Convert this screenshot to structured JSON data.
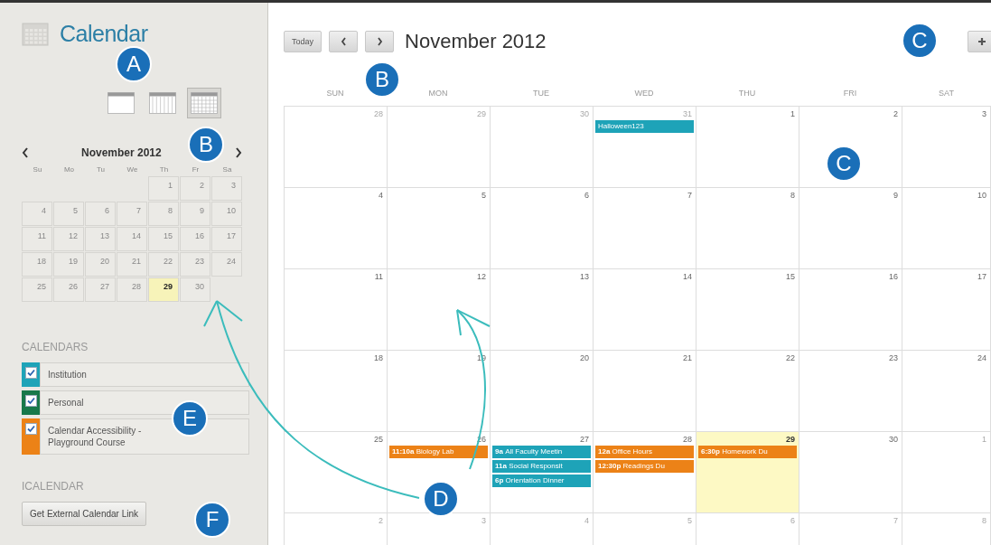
{
  "sidebar": {
    "title": "Calendar",
    "views": [
      {
        "kind": "day",
        "selected": false
      },
      {
        "kind": "week",
        "selected": false
      },
      {
        "kind": "month",
        "selected": true
      }
    ],
    "mini_calendar": {
      "month": "November 2012",
      "weekdays": [
        "Su",
        "Mo",
        "Tu",
        "We",
        "Th",
        "Fr",
        "Sa"
      ],
      "weeks": [
        [
          {
            "kind": "blank"
          },
          {
            "kind": "blank"
          },
          {
            "kind": "blank"
          },
          {
            "kind": "blank"
          },
          {
            "kind": "day",
            "day": "1",
            "today": false
          },
          {
            "kind": "day",
            "day": "2",
            "today": false
          },
          {
            "kind": "day",
            "day": "3",
            "today": false
          }
        ],
        [
          {
            "kind": "day",
            "day": "4",
            "today": false
          },
          {
            "kind": "day",
            "day": "5",
            "today": false
          },
          {
            "kind": "day",
            "day": "6",
            "today": false
          },
          {
            "kind": "day",
            "day": "7",
            "today": false
          },
          {
            "kind": "day",
            "day": "8",
            "today": false
          },
          {
            "kind": "day",
            "day": "9",
            "today": false
          },
          {
            "kind": "day",
            "day": "10",
            "today": false
          }
        ],
        [
          {
            "kind": "day",
            "day": "11",
            "today": false
          },
          {
            "kind": "day",
            "day": "12",
            "today": false
          },
          {
            "kind": "day",
            "day": "13",
            "today": false
          },
          {
            "kind": "day",
            "day": "14",
            "today": false
          },
          {
            "kind": "day",
            "day": "15",
            "today": false
          },
          {
            "kind": "day",
            "day": "16",
            "today": false
          },
          {
            "kind": "day",
            "day": "17",
            "today": false
          }
        ],
        [
          {
            "kind": "day",
            "day": "18",
            "today": false
          },
          {
            "kind": "day",
            "day": "19",
            "today": false
          },
          {
            "kind": "day",
            "day": "20",
            "today": false
          },
          {
            "kind": "day",
            "day": "21",
            "today": false
          },
          {
            "kind": "day",
            "day": "22",
            "today": false
          },
          {
            "kind": "day",
            "day": "23",
            "today": false
          },
          {
            "kind": "day",
            "day": "24",
            "today": false
          }
        ],
        [
          {
            "kind": "day",
            "day": "25",
            "today": false
          },
          {
            "kind": "day",
            "day": "26",
            "today": false
          },
          {
            "kind": "day",
            "day": "27",
            "today": false
          },
          {
            "kind": "day",
            "day": "28",
            "today": false
          },
          {
            "kind": "day",
            "day": "29",
            "today": true
          },
          {
            "kind": "day",
            "day": "30",
            "today": false
          },
          {
            "kind": "blank"
          }
        ]
      ]
    },
    "calendars_heading": "CALENDARS",
    "calendars": [
      {
        "name": "Institution",
        "checked": true,
        "color": "#1ea3b8"
      },
      {
        "name": "Personal",
        "checked": true,
        "color": "#17784a"
      },
      {
        "name": "Calendar Accessibility - Playground Course",
        "checked": true,
        "color": "#ec8217"
      }
    ],
    "icalendar_heading": "ICALENDAR",
    "link_button": "Get External Calendar Link"
  },
  "main": {
    "today_button": "Today",
    "title": "November 2012",
    "weekdays": [
      "SUN",
      "MON",
      "TUE",
      "WED",
      "THU",
      "FRI",
      "SAT"
    ],
    "weeks": [
      [
        {
          "day": "28",
          "other_month": true,
          "today": false
        },
        {
          "day": "29",
          "other_month": true,
          "today": false
        },
        {
          "day": "30",
          "other_month": true,
          "today": false
        },
        {
          "day": "31",
          "other_month": true,
          "today": false,
          "events": [
            {
              "title": "Halloween123",
              "color": "#1ea3b8"
            }
          ]
        },
        {
          "day": "1",
          "other_month": false,
          "today": false
        },
        {
          "day": "2",
          "other_month": false,
          "today": false
        },
        {
          "day": "3",
          "other_month": false,
          "today": false
        }
      ],
      [
        {
          "day": "4",
          "other_month": false,
          "today": false
        },
        {
          "day": "5",
          "other_month": false,
          "today": false
        },
        {
          "day": "6",
          "other_month": false,
          "today": false
        },
        {
          "day": "7",
          "other_month": false,
          "today": false
        },
        {
          "day": "8",
          "other_month": false,
          "today": false
        },
        {
          "day": "9",
          "other_month": false,
          "today": false
        },
        {
          "day": "10",
          "other_month": false,
          "today": false
        }
      ],
      [
        {
          "day": "11",
          "other_month": false,
          "today": false
        },
        {
          "day": "12",
          "other_month": false,
          "today": false
        },
        {
          "day": "13",
          "other_month": false,
          "today": false
        },
        {
          "day": "14",
          "other_month": false,
          "today": false
        },
        {
          "day": "15",
          "other_month": false,
          "today": false
        },
        {
          "day": "16",
          "other_month": false,
          "today": false
        },
        {
          "day": "17",
          "other_month": false,
          "today": false
        }
      ],
      [
        {
          "day": "18",
          "other_month": false,
          "today": false
        },
        {
          "day": "19",
          "other_month": false,
          "today": false
        },
        {
          "day": "20",
          "other_month": false,
          "today": false
        },
        {
          "day": "21",
          "other_month": false,
          "today": false
        },
        {
          "day": "22",
          "other_month": false,
          "today": false
        },
        {
          "day": "23",
          "other_month": false,
          "today": false
        },
        {
          "day": "24",
          "other_month": false,
          "today": false
        }
      ],
      [
        {
          "day": "25",
          "other_month": false,
          "today": false
        },
        {
          "day": "26",
          "other_month": false,
          "today": false,
          "events": [
            {
              "time": "11:10a",
              "title": "Biology Lab",
              "color": "#ec8217"
            }
          ]
        },
        {
          "day": "27",
          "other_month": false,
          "today": false,
          "events": [
            {
              "time": "9a",
              "title": "All Faculty Meetin",
              "color": "#1ea3b8"
            },
            {
              "time": "11a",
              "title": "Social Responsit",
              "color": "#1ea3b8"
            },
            {
              "time": "6p",
              "title": "Orientation Dinner",
              "color": "#1ea3b8"
            }
          ]
        },
        {
          "day": "28",
          "other_month": false,
          "today": false,
          "events": [
            {
              "time": "12a",
              "title": "Office Hours",
              "color": "#ec8217"
            },
            {
              "time": "12:30p",
              "title": "Readings Du",
              "color": "#ec8217"
            }
          ]
        },
        {
          "day": "29",
          "other_month": false,
          "today": true,
          "events": [
            {
              "time": "6:30p",
              "title": "Homework Du",
              "color": "#ec8217"
            }
          ]
        },
        {
          "day": "30",
          "other_month": false,
          "today": false
        },
        {
          "day": "1",
          "other_month": true,
          "today": false
        }
      ],
      [
        {
          "day": "2",
          "other_month": true,
          "today": false
        },
        {
          "day": "3",
          "other_month": true,
          "today": false
        },
        {
          "day": "4",
          "other_month": true,
          "today": false
        },
        {
          "day": "5",
          "other_month": true,
          "today": false
        },
        {
          "day": "6",
          "other_month": true,
          "today": false
        },
        {
          "day": "7",
          "other_month": true,
          "today": false
        },
        {
          "day": "8",
          "other_month": true,
          "today": false
        }
      ]
    ]
  },
  "callouts": [
    "A",
    "B",
    "B",
    "C",
    "C",
    "D",
    "E",
    "F"
  ]
}
